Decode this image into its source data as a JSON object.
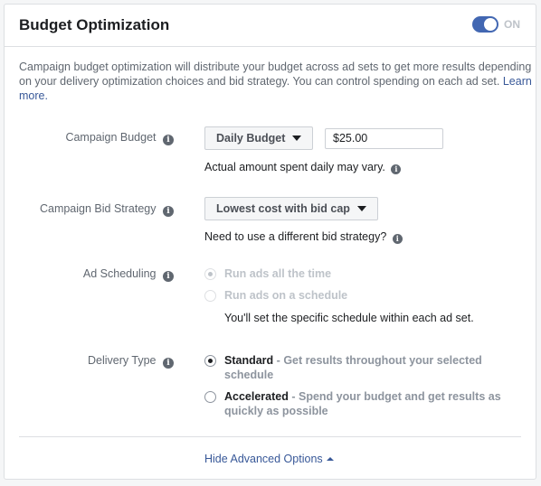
{
  "header": {
    "title": "Budget Optimization",
    "toggle_state": "ON",
    "toggle_on": true,
    "accent_color": "#4267b2"
  },
  "description": {
    "text": "Campaign budget optimization will distribute your budget across ad sets to get more results depending on your delivery optimization choices and bid strategy. You can control spending on each ad set.",
    "link_label": "Learn more."
  },
  "campaign_budget": {
    "label": "Campaign Budget",
    "dropdown_value": "Daily Budget",
    "amount_value": "$25.00",
    "note": "Actual amount spent daily may vary."
  },
  "bid_strategy": {
    "label": "Campaign Bid Strategy",
    "dropdown_value": "Lowest cost with bid cap",
    "note": "Need to use a different bid strategy?"
  },
  "ad_scheduling": {
    "label": "Ad Scheduling",
    "options": [
      {
        "label": "Run ads all the time",
        "selected": true,
        "disabled": true
      },
      {
        "label": "Run ads on a schedule",
        "selected": false,
        "disabled": true
      }
    ],
    "note": "You'll set the specific schedule within each ad set."
  },
  "delivery_type": {
    "label": "Delivery Type",
    "options": [
      {
        "title": "Standard",
        "description": "Get results throughout your selected schedule",
        "selected": true
      },
      {
        "title": "Accelerated",
        "description": "Spend your budget and get results as quickly as possible",
        "selected": false
      }
    ]
  },
  "footer": {
    "link_label": "Hide Advanced Options"
  }
}
